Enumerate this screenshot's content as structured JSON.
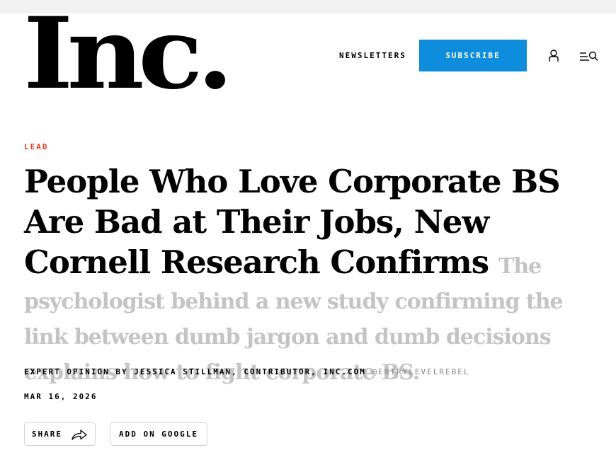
{
  "header": {
    "logo_text": "Inc.",
    "newsletters_label": "NEWSLETTERS",
    "subscribe_label": "SUBSCRIBE",
    "icons": [
      "user-icon",
      "menu-search-icon"
    ]
  },
  "article": {
    "kicker": "LEAD",
    "headline": "People Who Love Corporate BS Are Bad at Their Jobs, New Cornell Research Confirms",
    "subheadline": "The psychologist behind a new study confirming the link between dumb jargon and dumb decisions explains how to fight corporate BS.",
    "byline_prefix": "EXPERT OPINION BY",
    "author": "JESSICA STILLMAN, CONTRIBUTOR, INC.COM",
    "author_handle": "@ENTRYLEVELREBEL",
    "date": "MAR 16, 2026",
    "share_label": "SHARE",
    "google_label": "ADD ON GOOGLE"
  },
  "colors": {
    "accent_blue": "#0d8ddb",
    "kicker_orange": "#e8401c",
    "subheadline_gray": "#c4c4c4"
  }
}
